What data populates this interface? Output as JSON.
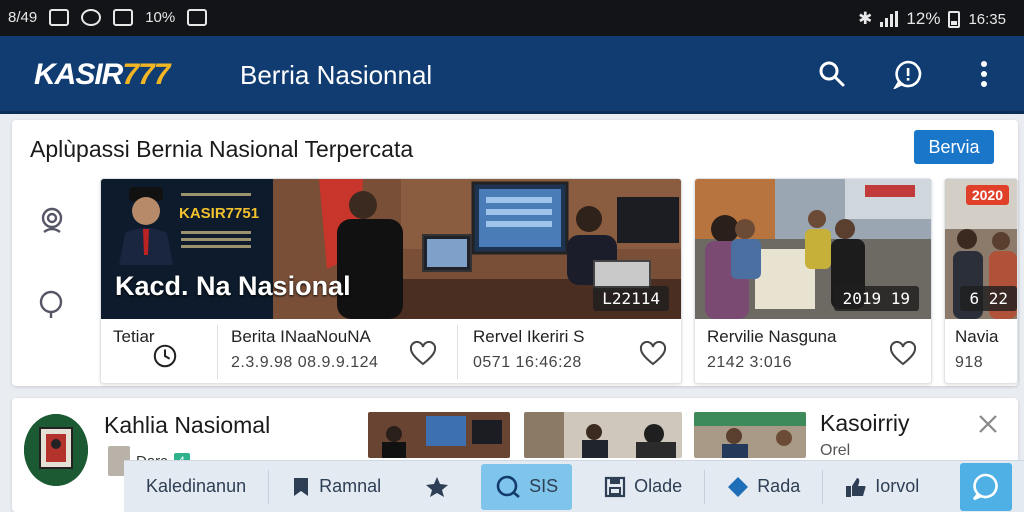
{
  "status_bar": {
    "time_left": "8/49",
    "percent_left": "10%",
    "battery": "12%",
    "clock": "16:35"
  },
  "app_bar": {
    "brand_main": "KASIR",
    "brand_num": "777",
    "title": "Berria Nasionnal",
    "actions": [
      "search-icon",
      "chat-icon",
      "more-vert-icon"
    ]
  },
  "featured": {
    "title": "Aplùpassi Bernia Nasional Terpercata",
    "button": "Bervia",
    "side_icons": [
      "profile-icon",
      "search-icon"
    ],
    "cards": [
      {
        "promo_brand": "KASIR7751",
        "overlay": "Kacd. Na Nasional",
        "badge": "L22114",
        "items": [
          {
            "title": "Tetiar",
            "date": ""
          },
          {
            "title": "Berita INaaNouNA",
            "date": "2.3.9.98 08.9.9.124"
          },
          {
            "title": "Rervel Ikeriri S",
            "date": "0571 16:46:28"
          }
        ]
      },
      {
        "badge": "2019 19",
        "title": "Rervilie Nasguna",
        "date": "2142 3:016"
      },
      {
        "badge_red": "2020",
        "badge": "6 22",
        "title": "Navia",
        "date": "918"
      }
    ]
  },
  "lower": {
    "title": "Kahlia Nasiomal",
    "dark_label": "Darc",
    "dark_tag": "4",
    "right_title": "Kasoirriy",
    "right_sub": "Orel"
  },
  "bottom_nav": {
    "items": [
      {
        "label": "Kaledinanun",
        "icon": ""
      },
      {
        "label": "Ramnal",
        "icon": "bookmark-icon"
      },
      {
        "label": "",
        "icon": "star-icon"
      },
      {
        "label": "SIS",
        "icon": "chat-icon"
      },
      {
        "label": "Olade",
        "icon": "save-icon"
      },
      {
        "label": "Rada",
        "icon": "diamond-icon"
      },
      {
        "label": "Iorvol",
        "icon": "thumb-icon"
      }
    ],
    "last_icon": "chat-bubble-icon"
  }
}
